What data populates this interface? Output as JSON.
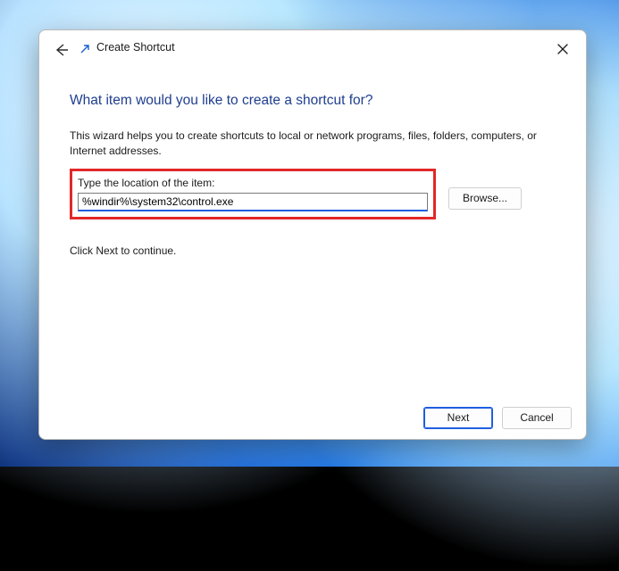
{
  "window": {
    "title": "Create Shortcut"
  },
  "heading": "What item would you like to create a shortcut for?",
  "description": "This wizard helps you to create shortcuts to local or network programs, files, folders, computers, or Internet addresses.",
  "location_label": "Type the location of the item:",
  "location_value": "%windir%\\system32\\control.exe",
  "browse_label": "Browse...",
  "continue_hint": "Click Next to continue.",
  "footer": {
    "next": "Next",
    "cancel": "Cancel"
  }
}
